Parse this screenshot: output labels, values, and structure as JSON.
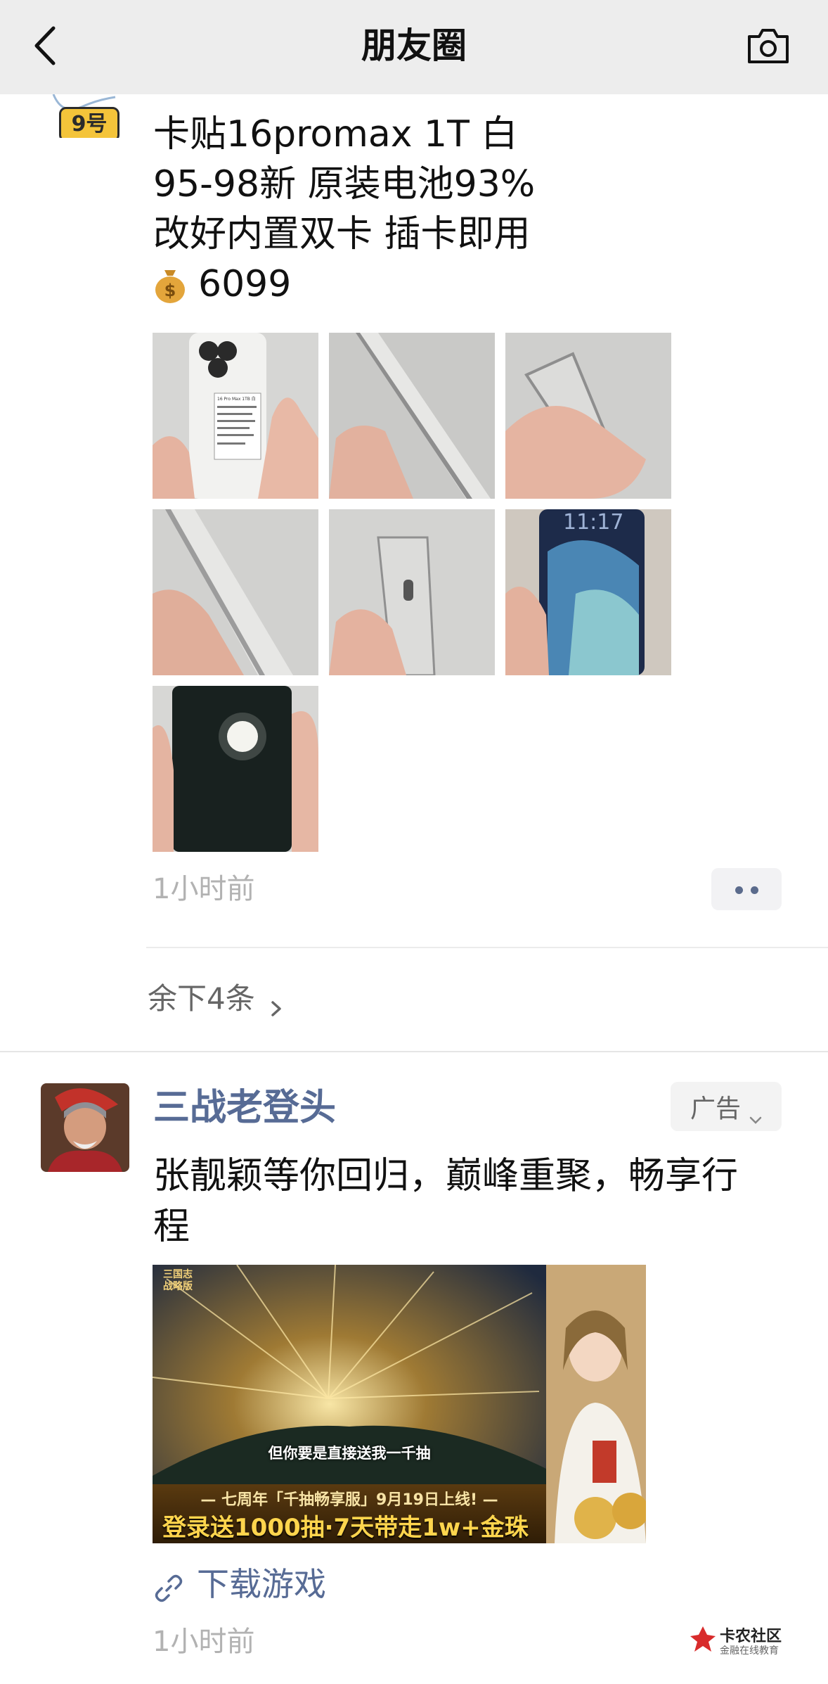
{
  "navbar": {
    "title": "朋友圈"
  },
  "post1": {
    "avatar_badge": "9号",
    "lines": [
      "卡贴16promax 1T 白",
      "95-98新 原装电池93%",
      "改好内置双卡 插卡即用"
    ],
    "price": "6099",
    "label_header": "16 Pro Max 1TB 白",
    "time": "1小时前",
    "more_remaining": "余下4条"
  },
  "post2": {
    "name": "三战老登头",
    "ad_label": "广告",
    "text": "张靓颖等你回归，巅峰重聚，畅享行程",
    "banner": {
      "subtitle": "但你要是直接送我一千抽",
      "small_line": "— 七周年「千抽畅享服」9月19日上线! —",
      "big_line": "登录送1000抽·7天带走1w+金珠",
      "logo_text": "三国志 战略版"
    },
    "download_label": "下载游戏",
    "time": "1小时前"
  },
  "watermark": {
    "title": "卡农社区",
    "subtitle": "金融在线教育"
  }
}
